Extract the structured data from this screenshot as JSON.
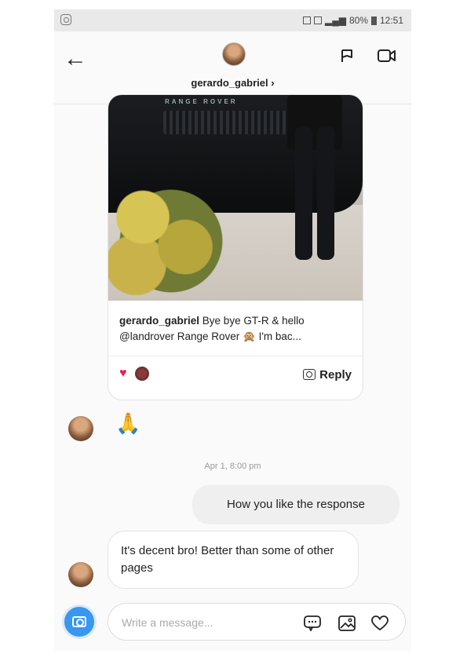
{
  "status_bar": {
    "battery": "80%",
    "time": "12:51"
  },
  "header": {
    "username": "gerardo_gabriel",
    "chevron": "›"
  },
  "shared_post": {
    "plate_text": "RANGE ROVER",
    "author": "gerardo_gabriel",
    "caption_line1": " Bye bye GT-R & hello",
    "caption_line2": "@landrover Range Rover 🙊 I'm bac...",
    "reply_label": "Reply",
    "liked_icon": "heart-icon"
  },
  "messages": [
    {
      "sender": "other",
      "emoji": "🙏"
    },
    {
      "sender": "me",
      "text": "How you like the response"
    },
    {
      "sender": "other",
      "text": "It's decent bro! Better than some of other pages"
    }
  ],
  "timestamp": "Apr 1, 8:00 pm",
  "composer": {
    "placeholder": "Write a message..."
  }
}
